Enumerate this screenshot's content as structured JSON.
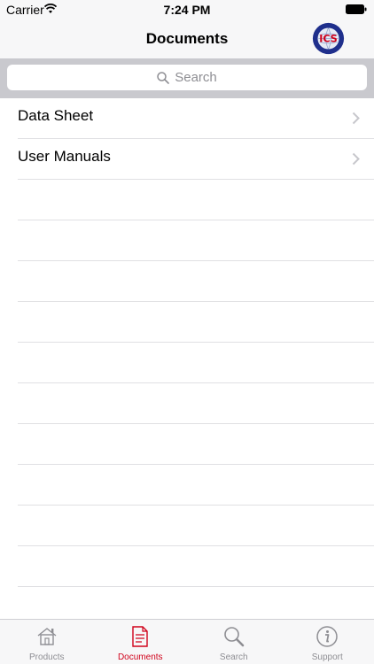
{
  "status_bar": {
    "carrier": "Carrier",
    "time": "7:24 PM"
  },
  "nav": {
    "title": "Documents",
    "logo_letters": "ICS"
  },
  "search": {
    "placeholder": "Search"
  },
  "list": {
    "items": [
      {
        "label": "Data Sheet"
      },
      {
        "label": "User Manuals"
      }
    ]
  },
  "tabbar": {
    "tabs": [
      {
        "label": "Products",
        "icon": "house-icon"
      },
      {
        "label": "Documents",
        "icon": "document-icon",
        "active": true
      },
      {
        "label": "Search",
        "icon": "magnifier-icon"
      },
      {
        "label": "Support",
        "icon": "info-icon"
      }
    ]
  },
  "colors": {
    "accent": "#d0021b",
    "inactive": "#8e8e93",
    "search_bg": "#c9c9ce"
  }
}
